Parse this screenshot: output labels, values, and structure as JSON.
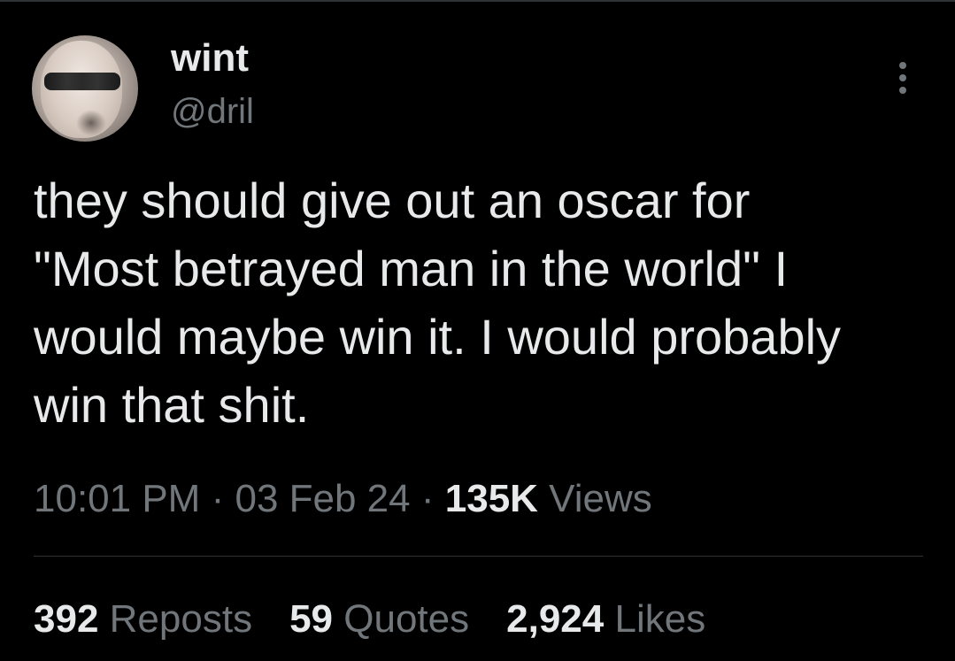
{
  "author": {
    "display_name": "wint",
    "handle": "@dril"
  },
  "tweet": {
    "text": "they should give out an oscar for\n\"Most betrayed man in the world\" I\nwould maybe win it. I would probably\nwin that shit."
  },
  "meta": {
    "time": "10:01 PM",
    "separator": "·",
    "date": "03 Feb 24",
    "views_count": "135K",
    "views_label": "Views"
  },
  "stats": {
    "reposts_count": "392",
    "reposts_label": "Reposts",
    "quotes_count": "59",
    "quotes_label": "Quotes",
    "likes_count": "2,924",
    "likes_label": "Likes"
  },
  "icons": {
    "more": "more-options-icon"
  },
  "colors": {
    "background": "#000000",
    "primary_text": "#e7e9ea",
    "secondary_text": "#71767b",
    "divider": "#2f3336"
  }
}
